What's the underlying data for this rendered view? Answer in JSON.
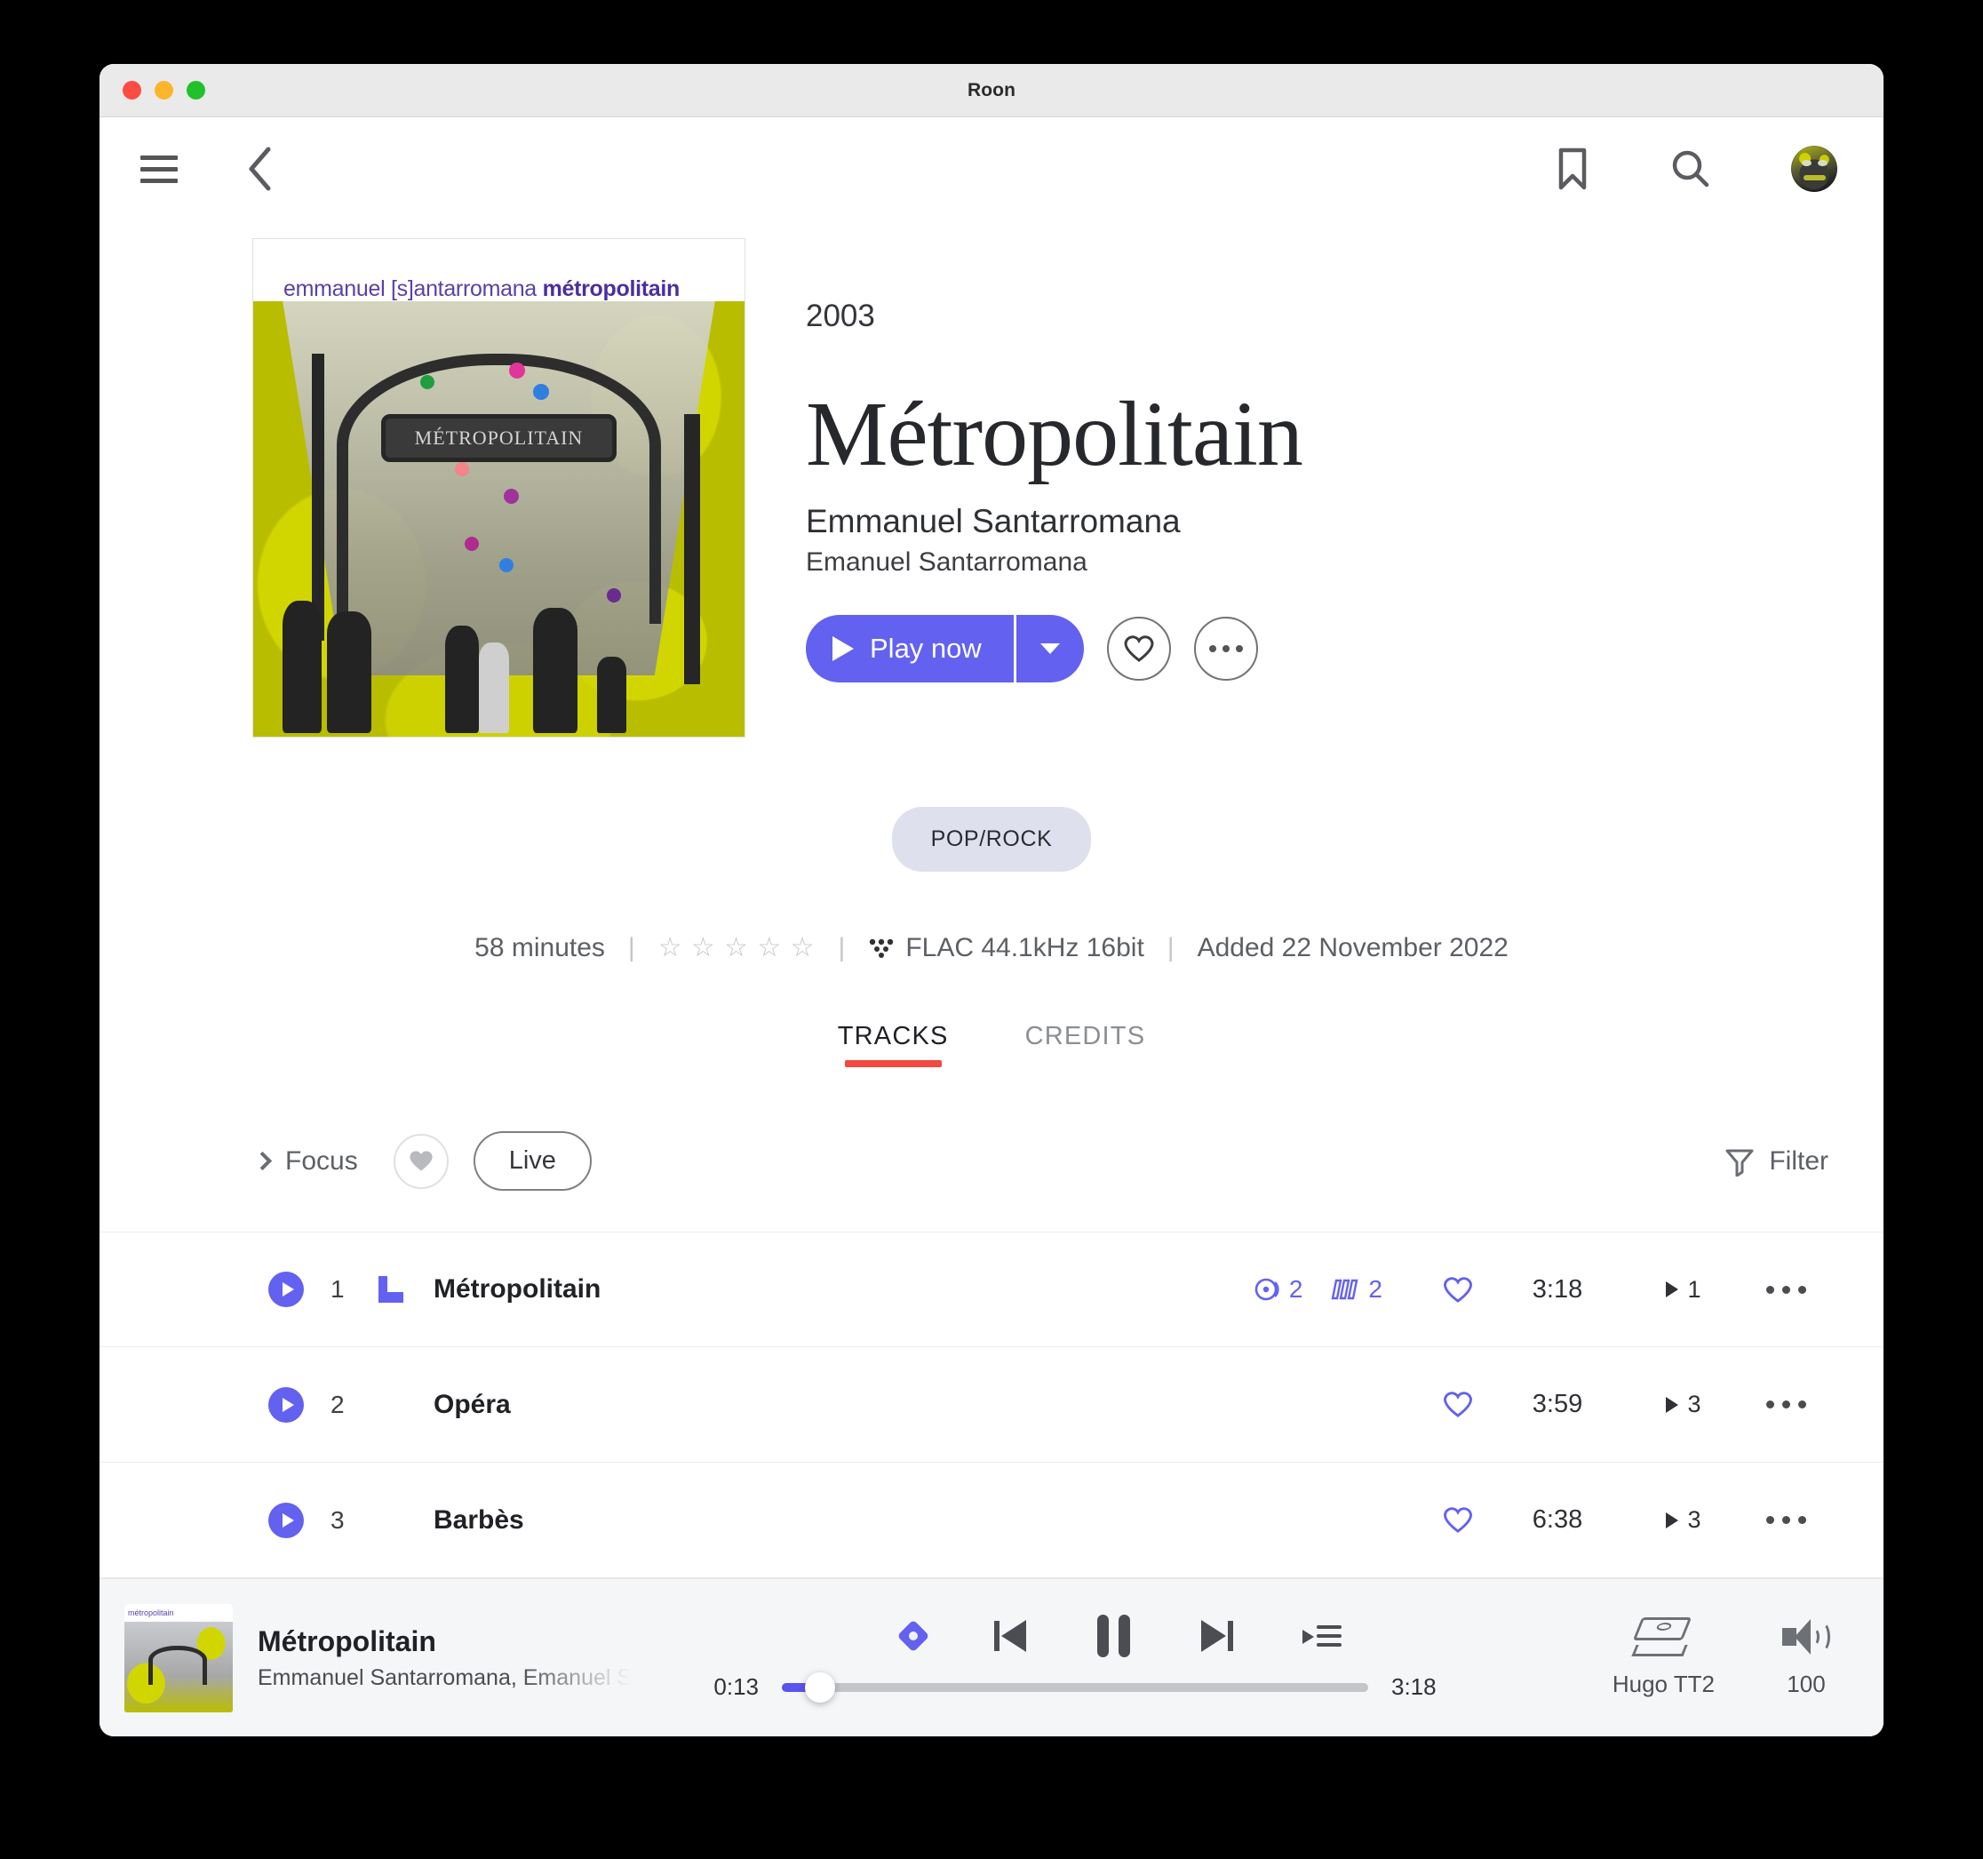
{
  "window": {
    "title": "Roon",
    "traffic_lights": [
      "close",
      "minimize",
      "zoom"
    ]
  },
  "topnav": {
    "menu_icon": "hamburger-icon",
    "back_icon": "chevron-left-icon",
    "bookmark_icon": "bookmark-icon",
    "search_icon": "search-icon",
    "avatar_icon": "user-avatar"
  },
  "album": {
    "cover_credit": "emmanuel [s]antarromana ",
    "cover_credit_bold": "métropolitain",
    "cover_sign_text": "MÉTROPOLITAIN",
    "year": "2003",
    "title": "Métropolitain",
    "artist_primary": "Emmanuel Santarromana",
    "artist_secondary": "Emanuel Santarromana",
    "genre": "POP/ROCK"
  },
  "actions": {
    "play_label": "Play now",
    "play_icon": "play-icon",
    "dropdown_icon": "chevron-down-icon",
    "favorite_icon": "heart-outline-icon",
    "more_icon": "ellipsis-icon"
  },
  "meta": {
    "duration": "58 minutes",
    "rating_stars": "☆ ☆ ☆ ☆ ☆",
    "rating_value": 0,
    "format_icon": "audio-quality-icon",
    "format": "FLAC 44.1kHz 16bit",
    "added": "Added 22 November 2022",
    "separator": "|"
  },
  "tabs": [
    {
      "label": "TRACKS",
      "active": true
    },
    {
      "label": "CREDITS",
      "active": false
    }
  ],
  "filterbar": {
    "focus_label": "Focus",
    "focus_icon": "chevron-right-icon",
    "heart_icon": "heart-filled-icon",
    "live_label": "Live",
    "filter_label": "Filter",
    "filter_icon": "funnel-icon"
  },
  "track_columns": [
    "play",
    "number",
    "flag",
    "title",
    "badges",
    "favorite",
    "duration",
    "playcount",
    "more"
  ],
  "tracks": [
    {
      "number": "1",
      "title": "Métropolitain",
      "now_playing_flag": true,
      "versions_icon": "equalizer-disc-icon",
      "versions_count": "2",
      "related_icon": "multiple-versions-icon",
      "related_count": "2",
      "favorite_icon": "heart-outline-icon",
      "duration": "3:18",
      "play_icon": "play-small-icon",
      "play_count": "1",
      "more_icon": "ellipsis-icon"
    },
    {
      "number": "2",
      "title": "Opéra",
      "now_playing_flag": false,
      "versions_count": "",
      "related_count": "",
      "favorite_icon": "heart-outline-icon",
      "duration": "3:59",
      "play_icon": "play-small-icon",
      "play_count": "3",
      "more_icon": "ellipsis-icon"
    },
    {
      "number": "3",
      "title": "Barbès",
      "now_playing_flag": false,
      "versions_count": "",
      "related_count": "",
      "favorite_icon": "heart-outline-icon",
      "duration": "6:38",
      "play_icon": "play-small-icon",
      "play_count": "3",
      "more_icon": "ellipsis-icon"
    }
  ],
  "player": {
    "now_playing_title": "Métropolitain",
    "now_playing_artist": "Emmanuel Santarromana, Emanuel S",
    "signal_path_icon": "signal-path-diamond-icon",
    "previous_icon": "previous-track-icon",
    "pause_icon": "pause-icon",
    "next_icon": "next-track-icon",
    "queue_icon": "queue-icon",
    "time_current": "0:13",
    "time_total": "3:18",
    "progress_percent": 6.5,
    "zone_icon": "dac-device-icon",
    "zone_name": "Hugo TT2",
    "volume_icon": "speaker-volume-icon",
    "volume_value": "100"
  },
  "colors": {
    "accent": "#6361f0",
    "tab_underline": "#f04a41",
    "genre_pill_bg": "#dfe0ee",
    "player_bg": "#f5f6f8",
    "titlebar_bg": "#eaeaea"
  }
}
